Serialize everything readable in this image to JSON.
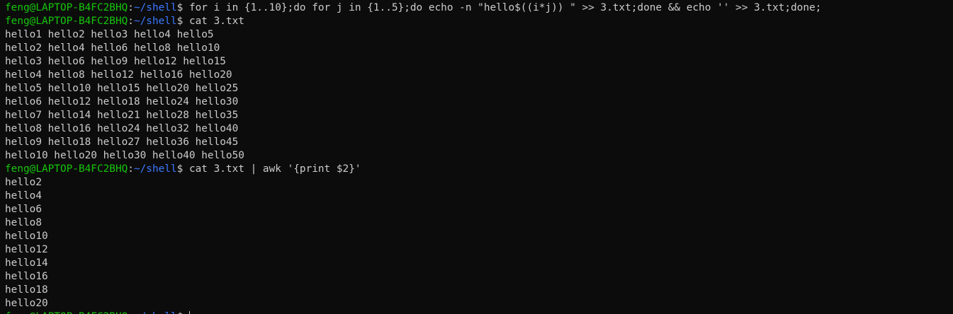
{
  "prompt": {
    "user_host": "feng@LAPTOP-B4FC2BHQ",
    "separator": ":",
    "path": "~/shell",
    "dollar": "$"
  },
  "commands": {
    "first": "for i in {1..10};do for j in {1..5};do echo -n \"hello$((i*j)) \" >> 3.txt;done && echo '' >> 3.txt;done;",
    "second": "cat 3.txt",
    "third": "cat 3.txt | awk '{print $2}'"
  },
  "cat_output": [
    "hello1 hello2 hello3 hello4 hello5",
    "hello2 hello4 hello6 hello8 hello10",
    "hello3 hello6 hello9 hello12 hello15",
    "hello4 hello8 hello12 hello16 hello20",
    "hello5 hello10 hello15 hello20 hello25",
    "hello6 hello12 hello18 hello24 hello30",
    "hello7 hello14 hello21 hello28 hello35",
    "hello8 hello16 hello24 hello32 hello40",
    "hello9 hello18 hello27 hello36 hello45",
    "hello10 hello20 hello30 hello40 hello50"
  ],
  "awk_output": [
    "hello2",
    "hello4",
    "hello6",
    "hello8",
    "hello10",
    "hello12",
    "hello14",
    "hello16",
    "hello18",
    "hello20"
  ]
}
